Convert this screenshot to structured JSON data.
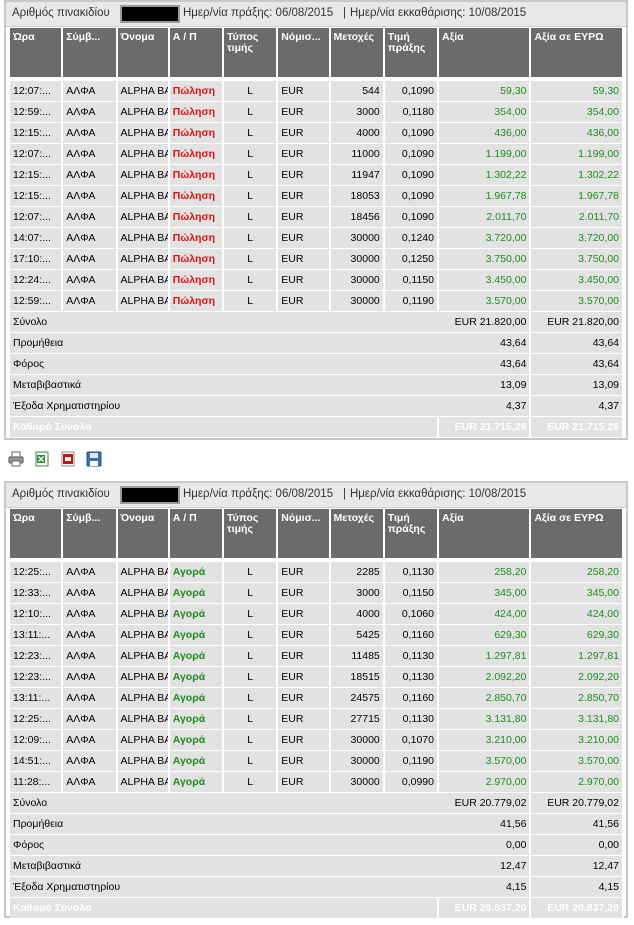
{
  "headers": [
    "Ώρα",
    "Σύμβ...",
    "Όνομα",
    "Α / Π",
    "Τύπος τιμής",
    "Νόμισ...",
    "Μετοχές",
    "Τιμή πράξης",
    "Αξία",
    "Αξία σε ΕΥΡΩ"
  ],
  "labels": {
    "total": "Σύνολο",
    "commission": "Προμήθεια",
    "tax": "Φόρος",
    "transfer": "Μεταβιβαστικά",
    "exchange_fees": "Έξοδα Χρηματιστηρίου",
    "net_total": "Καθαρό Σύνολο"
  },
  "toolbar": {
    "print_icon": "printer-icon",
    "excel_icon": "excel-icon",
    "pdf_icon": "pdf-icon",
    "save_icon": "save-icon"
  },
  "notes": [
    {
      "info": {
        "account_label": "Αριθμός πινακιδίου",
        "trade_date": "Ημερ/νία πράξης: 06/08/2015",
        "settle_date": "Ημερ/νία εκκαθάρισης: 10/08/2015"
      },
      "side_color": "#e01010",
      "rows": [
        [
          "12:07:...",
          "ΑΛΦΑ",
          "ALPHA BA",
          "Πώληση",
          "L",
          "EUR",
          "544",
          "0,1090",
          "59,30",
          "59,30"
        ],
        [
          "12:59:...",
          "ΑΛΦΑ",
          "ALPHA BA",
          "Πώληση",
          "L",
          "EUR",
          "3000",
          "0,1180",
          "354,00",
          "354,00"
        ],
        [
          "12:15:...",
          "ΑΛΦΑ",
          "ALPHA BA",
          "Πώληση",
          "L",
          "EUR",
          "4000",
          "0,1090",
          "436,00",
          "436,00"
        ],
        [
          "12:07:...",
          "ΑΛΦΑ",
          "ALPHA BA",
          "Πώληση",
          "L",
          "EUR",
          "11000",
          "0,1090",
          "1.199,00",
          "1.199,00"
        ],
        [
          "12:15:...",
          "ΑΛΦΑ",
          "ALPHA BA",
          "Πώληση",
          "L",
          "EUR",
          "11947",
          "0,1090",
          "1.302,22",
          "1.302,22"
        ],
        [
          "12:15:...",
          "ΑΛΦΑ",
          "ALPHA BA",
          "Πώληση",
          "L",
          "EUR",
          "18053",
          "0,1090",
          "1.967,78",
          "1.967,78"
        ],
        [
          "12:07:...",
          "ΑΛΦΑ",
          "ALPHA BA",
          "Πώληση",
          "L",
          "EUR",
          "18456",
          "0,1090",
          "2.011,70",
          "2.011,70"
        ],
        [
          "14:07:...",
          "ΑΛΦΑ",
          "ALPHA BA",
          "Πώληση",
          "L",
          "EUR",
          "30000",
          "0,1240",
          "3.720,00",
          "3.720,00"
        ],
        [
          "17:10:...",
          "ΑΛΦΑ",
          "ALPHA BA",
          "Πώληση",
          "L",
          "EUR",
          "30000",
          "0,1250",
          "3.750,00",
          "3.750,00"
        ],
        [
          "12:24:...",
          "ΑΛΦΑ",
          "ALPHA BA",
          "Πώληση",
          "L",
          "EUR",
          "30000",
          "0,1150",
          "3.450,00",
          "3.450,00"
        ],
        [
          "12:59:...",
          "ΑΛΦΑ",
          "ALPHA BA",
          "Πώληση",
          "L",
          "EUR",
          "30000",
          "0,1190",
          "3.570,00",
          "3.570,00"
        ]
      ],
      "summary": {
        "total": [
          "EUR 21.820,00",
          "EUR 21.820,00"
        ],
        "commission": [
          "43,64",
          "43,64"
        ],
        "tax": [
          "43,64",
          "43,64"
        ],
        "transfer": [
          "13,09",
          "13,09"
        ],
        "exchange_fees": [
          "4,37",
          "4,37"
        ],
        "net_total": [
          "EUR 21.715,26",
          "EUR 21.715,26"
        ]
      }
    },
    {
      "info": {
        "account_label": "Αριθμός πινακιδίου",
        "trade_date": "Ημερ/νία πράξης: 06/08/2015",
        "settle_date": "Ημερ/νία εκκαθάρισης: 10/08/2015"
      },
      "side_color": "#1f8c1f",
      "rows": [
        [
          "12:25:...",
          "ΑΛΦΑ",
          "ALPHA BA",
          "Αγορά",
          "L",
          "EUR",
          "2285",
          "0,1130",
          "258,20",
          "258,20"
        ],
        [
          "12:33:...",
          "ΑΛΦΑ",
          "ALPHA BA",
          "Αγορά",
          "L",
          "EUR",
          "3000",
          "0,1150",
          "345,00",
          "345,00"
        ],
        [
          "12:10:...",
          "ΑΛΦΑ",
          "ALPHA BA",
          "Αγορά",
          "L",
          "EUR",
          "4000",
          "0,1060",
          "424,00",
          "424,00"
        ],
        [
          "13:11:...",
          "ΑΛΦΑ",
          "ALPHA BA",
          "Αγορά",
          "L",
          "EUR",
          "5425",
          "0,1160",
          "629,30",
          "629,30"
        ],
        [
          "12:23:...",
          "ΑΛΦΑ",
          "ALPHA BA",
          "Αγορά",
          "L",
          "EUR",
          "11485",
          "0,1130",
          "1.297,81",
          "1.297,81"
        ],
        [
          "12:23:...",
          "ΑΛΦΑ",
          "ALPHA BA",
          "Αγορά",
          "L",
          "EUR",
          "18515",
          "0,1130",
          "2.092,20",
          "2.092,20"
        ],
        [
          "13:11:...",
          "ΑΛΦΑ",
          "ALPHA BA",
          "Αγορά",
          "L",
          "EUR",
          "24575",
          "0,1160",
          "2.850,70",
          "2.850,70"
        ],
        [
          "12:25:...",
          "ΑΛΦΑ",
          "ALPHA BA",
          "Αγορά",
          "L",
          "EUR",
          "27715",
          "0,1130",
          "3.131,80",
          "3.131,80"
        ],
        [
          "12:09:...",
          "ΑΛΦΑ",
          "ALPHA BA",
          "Αγορά",
          "L",
          "EUR",
          "30000",
          "0,1070",
          "3.210,00",
          "3.210,00"
        ],
        [
          "14:51:...",
          "ΑΛΦΑ",
          "ALPHA BA",
          "Αγορά",
          "L",
          "EUR",
          "30000",
          "0,1190",
          "3.570,00",
          "3.570,00"
        ],
        [
          "11:28:...",
          "ΑΛΦΑ",
          "ALPHA BA",
          "Αγορά",
          "L",
          "EUR",
          "30000",
          "0,0990",
          "2.970,00",
          "2.970,00"
        ]
      ],
      "summary": {
        "total": [
          "EUR 20.779,02",
          "EUR 20.779,02"
        ],
        "commission": [
          "41,56",
          "41,56"
        ],
        "tax": [
          "0,00",
          "0,00"
        ],
        "transfer": [
          "12,47",
          "12,47"
        ],
        "exchange_fees": [
          "4,15",
          "4,15"
        ],
        "net_total": [
          "EUR 20.837,20",
          "EUR 20.837,20"
        ]
      }
    }
  ]
}
